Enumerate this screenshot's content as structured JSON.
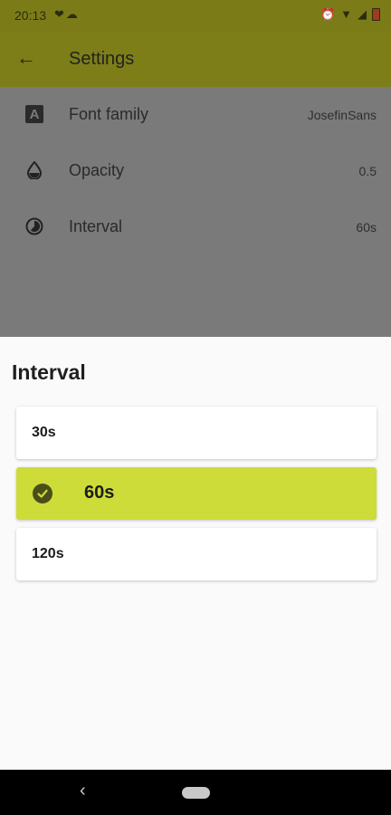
{
  "status_bar": {
    "time": "20:13",
    "left_icons": [
      "heart-broken-icon",
      "cloud-icon"
    ],
    "right_icons": [
      "alarm-icon",
      "wifi-icon",
      "signal-icon",
      "battery-icon"
    ]
  },
  "app_bar": {
    "title": "Settings",
    "back_icon": "arrow-left-icon",
    "color": "#7d7e18"
  },
  "settings": {
    "items": [
      {
        "label": "Font family",
        "value": "JosefinSans",
        "icon": "font-icon"
      },
      {
        "label": "Opacity",
        "value": "0.5",
        "icon": "opacity-drop-icon"
      },
      {
        "label": "Interval",
        "value": "60s",
        "icon": "timelapse-icon"
      }
    ]
  },
  "dialog": {
    "title": "Interval",
    "options": [
      {
        "label": "30s",
        "selected": false
      },
      {
        "label": "60s",
        "selected": true
      },
      {
        "label": "120s",
        "selected": false
      }
    ],
    "selected_color": "#cddc39"
  },
  "nav_bar": {
    "back_icon": "nav-back-icon",
    "home_icon": "nav-home-pill-icon"
  }
}
